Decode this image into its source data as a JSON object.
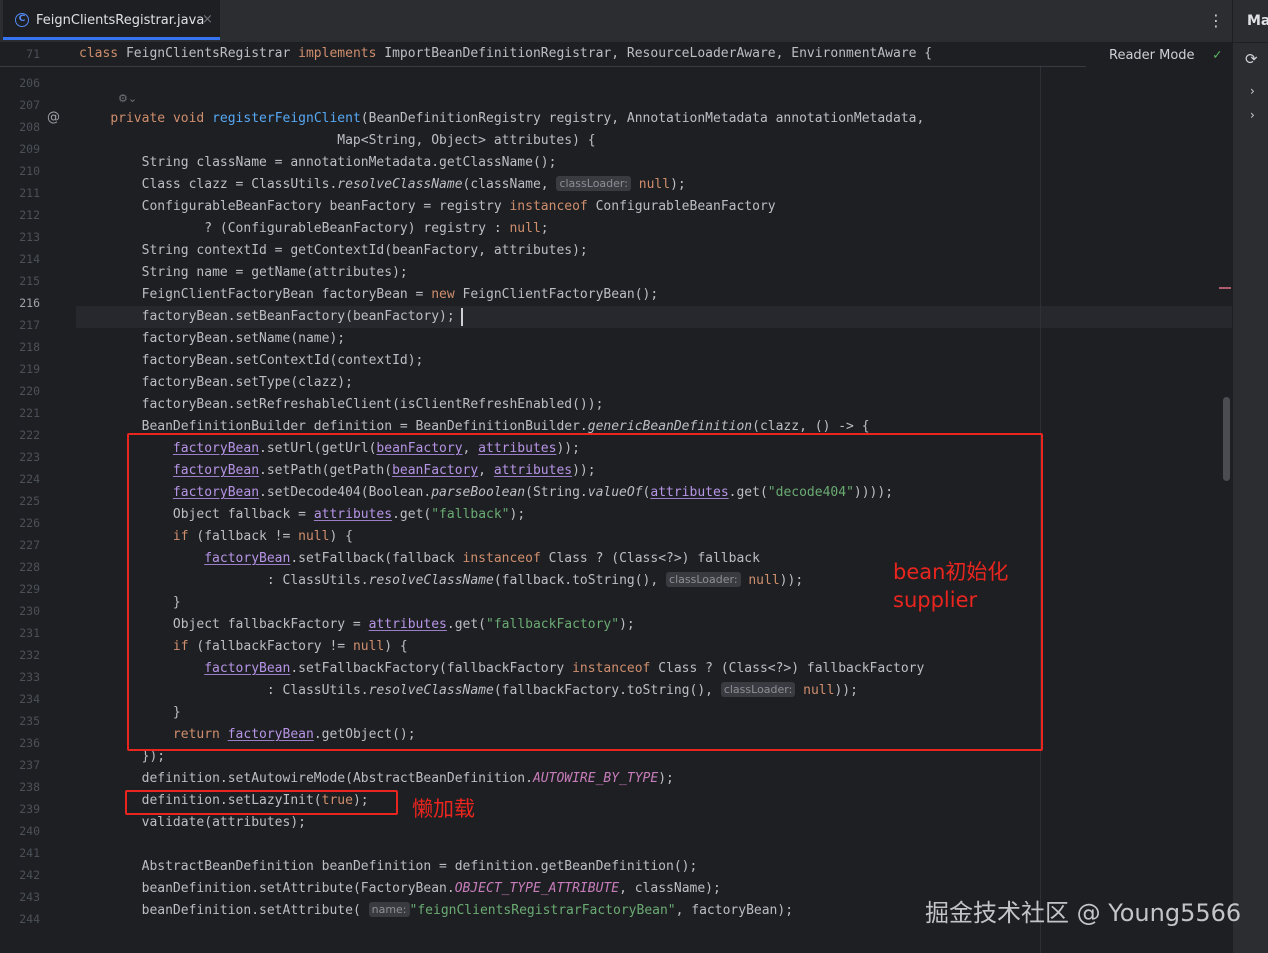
{
  "tab": {
    "icon": "class-icon",
    "icon_glyph": "C",
    "title": "FeignClientsRegistrar.java",
    "close": "×"
  },
  "toolbar": {
    "more": "⋮",
    "reader_mode": "Reader Mode",
    "check": "✓"
  },
  "right_panel": {
    "label": "Ma",
    "sync": "⟳",
    "arrow": "›"
  },
  "sticky_header": {
    "line_number": "71",
    "code": "class FeignClientsRegistrar implements ImportBeanDefinitionRegistrar, ResourceLoaderAware, EnvironmentAware {"
  },
  "gutter": {
    "at_icon": "@",
    "current_line": "216"
  },
  "line_numbers": [
    "206",
    "207",
    "208",
    "209",
    "210",
    "211",
    "212",
    "213",
    "214",
    "215",
    "216",
    "217",
    "218",
    "219",
    "220",
    "221",
    "222",
    "223",
    "224",
    "225",
    "226",
    "227",
    "228",
    "229",
    "230",
    "231",
    "232",
    "233",
    "234",
    "235",
    "236",
    "237",
    "238",
    "239",
    "240",
    "241",
    "242",
    "243",
    "244"
  ],
  "code": {
    "l207": {
      "kw1": "private",
      "kw2": "void",
      "fn": "registerFeignClient",
      "rest": "(BeanDefinitionRegistry registry, AnnotationMetadata annotationMetadata,"
    },
    "l208": "                                 Map<String, Object> attributes) {",
    "l209": "String className = annotationMetadata.getClassName();",
    "l210": {
      "a": "Class clazz = ClassUtils.",
      "it": "resolveClassName",
      "b": "(className, ",
      "hint": "classLoader:",
      "kw": "null",
      "c": ");"
    },
    "l211": {
      "a": "ConfigurableBeanFactory beanFactory = registry ",
      "kw": "instanceof",
      "b": " ConfigurableBeanFactory"
    },
    "l212": {
      "a": "        ? (ConfigurableBeanFactory) registry : ",
      "kw": "null",
      "b": ";"
    },
    "l213": "String contextId = getContextId(beanFactory, attributes);",
    "l214": "String name = getName(attributes);",
    "l215": {
      "a": "FeignClientFactoryBean factoryBean = ",
      "kw": "new",
      "b": " FeignClientFactoryBean();"
    },
    "l216": "factoryBean.setBeanFactory(beanFactory);",
    "l217": "factoryBean.setName(name);",
    "l218": "factoryBean.setContextId(contextId);",
    "l219": "factoryBean.setType(clazz);",
    "l220": "factoryBean.setRefreshableClient(isClientRefreshEnabled());",
    "l221": {
      "a": "BeanDefinitionBuilder definition = BeanDefinitionBuilder.",
      "it": "genericBeanDefinition",
      "b": "(clazz, () -> {"
    },
    "l222": {
      "v1": "factoryBean",
      "a": ".setUrl(getUrl(",
      "v2": "beanFactory",
      "b": ", ",
      "v3": "attributes",
      "c": "));"
    },
    "l223": {
      "v1": "factoryBean",
      "a": ".setPath(getPath(",
      "v2": "beanFactory",
      "b": ", ",
      "v3": "attributes",
      "c": "));"
    },
    "l224": {
      "v1": "factoryBean",
      "a": ".setDecode404(Boolean.",
      "it1": "parseBoolean",
      "b": "(String.",
      "it2": "valueOf",
      "c": "(",
      "v2": "attributes",
      "d": ".get(",
      "st": "\"decode404\"",
      "e": "))));"
    },
    "l225": {
      "a": "Object fallback = ",
      "v": "attributes",
      "b": ".get(",
      "st": "\"fallback\"",
      "c": ");"
    },
    "l226": {
      "kw": "if",
      "a": " (fallback != ",
      "kw2": "null",
      "b": ") {"
    },
    "l227": {
      "v": "factoryBean",
      "a": ".setFallback(fallback ",
      "kw": "instanceof",
      "b": " Class ? (Class<?>) fallback"
    },
    "l228": {
      "a": "        : ClassUtils.",
      "it": "resolveClassName",
      "b": "(fallback.toString(), ",
      "hint": "classLoader:",
      "kw": "null",
      "c": "));"
    },
    "l229": "}",
    "l230": {
      "a": "Object fallbackFactory = ",
      "v": "attributes",
      "b": ".get(",
      "st": "\"fallbackFactory\"",
      "c": ");"
    },
    "l231": {
      "kw": "if",
      "a": " (fallbackFactory != ",
      "kw2": "null",
      "b": ") {"
    },
    "l232": {
      "v": "factoryBean",
      "a": ".setFallbackFactory(fallbackFactory ",
      "kw": "instanceof",
      "b": " Class ? (Class<?>) fallbackFactory"
    },
    "l233": {
      "a": "        : ClassUtils.",
      "it": "resolveClassName",
      "b": "(fallbackFactory.toString(), ",
      "hint": "classLoader:",
      "kw": "null",
      "c": "));"
    },
    "l234": "}",
    "l235": {
      "kw": "return",
      "a": " ",
      "v": "factoryBean",
      "b": ".getObject();"
    },
    "l236": "});",
    "l237": {
      "a": "definition.setAutowireMode(AbstractBeanDefinition.",
      "cst": "AUTOWIRE_BY_TYPE",
      "b": ");"
    },
    "l238": {
      "a": "definition.setLazyInit(",
      "kw": "true",
      "b": ");"
    },
    "l239": "validate(attributes);",
    "l241": "AbstractBeanDefinition beanDefinition = definition.getBeanDefinition();",
    "l242": {
      "a": "beanDefinition.setAttribute(FactoryBean.",
      "cst": "OBJECT_TYPE_ATTRIBUTE",
      "b": ", className);"
    },
    "l243": {
      "a": "beanDefinition.setAttribute( ",
      "hint": "name:",
      "st": "\"feignClientsRegistrarFactoryBean\"",
      "b": ", factoryBean);"
    }
  },
  "annotations": {
    "supplier": "bean初始化\nsupplier",
    "lazy": "懒加载",
    "color": "#e8251f"
  },
  "watermark": "掘金技术社区 @ Young5566",
  "colors": {
    "background": "#1e1f22",
    "keyword": "#cf8e6d",
    "function": "#56a8f5",
    "string": "#6aab73",
    "field": "#c77dbb",
    "accent": "#3574f0"
  }
}
